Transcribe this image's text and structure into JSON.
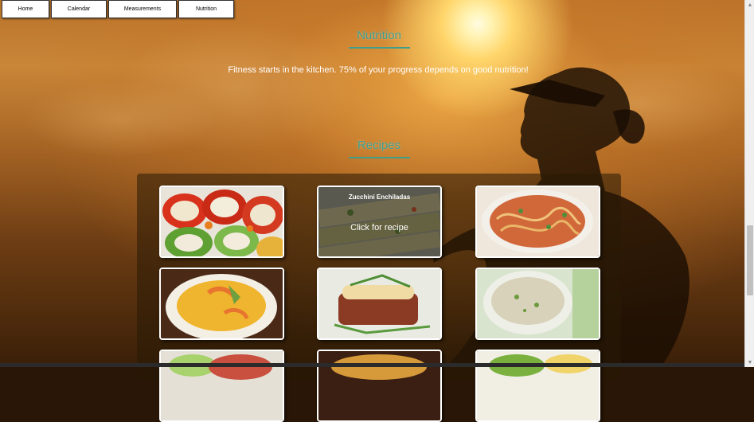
{
  "nav": {
    "items": [
      {
        "label": "Home"
      },
      {
        "label": "Calendar"
      },
      {
        "label": "Measurements"
      },
      {
        "label": "Nutrition"
      }
    ]
  },
  "nutrition": {
    "heading": "Nutrition",
    "tagline": "Fitness starts in the kitchen. 75% of your progress depends on good nutrition!"
  },
  "recipes": {
    "heading": "Recipes",
    "cards": [
      {
        "image": "stuffed-peppers-photo"
      },
      {
        "image": "zucchini-enchiladas-photo",
        "hover_title": "Zucchini Enchiladas",
        "hover_cta": "Click for recipe"
      },
      {
        "image": "spaghetti-photo"
      },
      {
        "image": "spaghetti-squash-shrimp-photo"
      },
      {
        "image": "eggplant-parmesan-photo"
      },
      {
        "image": "risotto-bowl-photo"
      },
      {
        "image": "recipe-photo-row3-1"
      },
      {
        "image": "recipe-photo-row3-2"
      },
      {
        "image": "recipe-photo-row3-3"
      }
    ]
  },
  "colors": {
    "heading_accent": "#3f9e8c",
    "nav_bg": "#ffffff",
    "tagline": "#ffffff"
  },
  "scrollbar": {
    "up_icon": "scroll-up-arrow-icon",
    "down_icon": "scroll-down-arrow-icon"
  }
}
